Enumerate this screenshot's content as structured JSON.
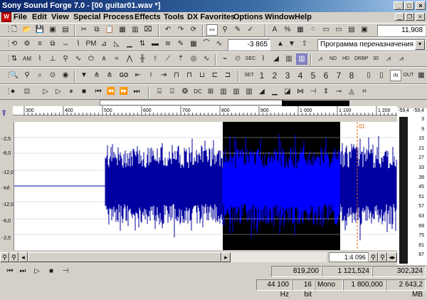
{
  "title": "Sony Sound Forge 7.0 - [00 guitar01.wav *]",
  "window_buttons": {
    "minimize": "_",
    "maximize": "□",
    "close": "×"
  },
  "menu": [
    "File",
    "Edit",
    "View",
    "Special",
    "Process",
    "Effects",
    "Tools",
    "DX Favorites",
    "Options",
    "Window",
    "Help"
  ],
  "toolbar": {
    "position_readout": "11,908",
    "level_value": "-3 865",
    "preset": "Программа переназначения звука",
    "set_label": "SET",
    "marker_nums": [
      "1",
      "2",
      "3",
      "4",
      "5",
      "6",
      "7",
      "8"
    ],
    "in_label": "IN",
    "out_label": "OUT"
  },
  "ruler": {
    "ticks": [
      "300",
      "400",
      "500",
      "600",
      "700",
      "800",
      "900",
      "1 000",
      "1 100",
      "1 200"
    ]
  },
  "db_scale": [
    "-2,5",
    "-6,0",
    "-12,0",
    "-Inf.",
    "-12,0",
    "-6,0",
    "-2,5"
  ],
  "meter": {
    "top_left": "-59,4",
    "top_right": "-59,4",
    "labels": [
      "3",
      "9",
      "15",
      "21",
      "27",
      "33",
      "39",
      "45",
      "51",
      "57",
      "63",
      "69",
      "75",
      "81",
      "87"
    ]
  },
  "marker_label": "01",
  "zoom_ratio": "1:4 096",
  "selection": {
    "start": "819,200",
    "end": "1 121,524",
    "length": "302,324"
  },
  "status": {
    "sample_rate": "44 100 Hz",
    "bit_depth": "16 bit",
    "channels": "Mono",
    "length": "1 800,000",
    "free_space": "2 643,2 MB"
  },
  "colors": {
    "wave": "#0000a0",
    "wave_selected": "#0000ff",
    "selection_bg": "#000000",
    "titlebar": "#0a246a"
  }
}
